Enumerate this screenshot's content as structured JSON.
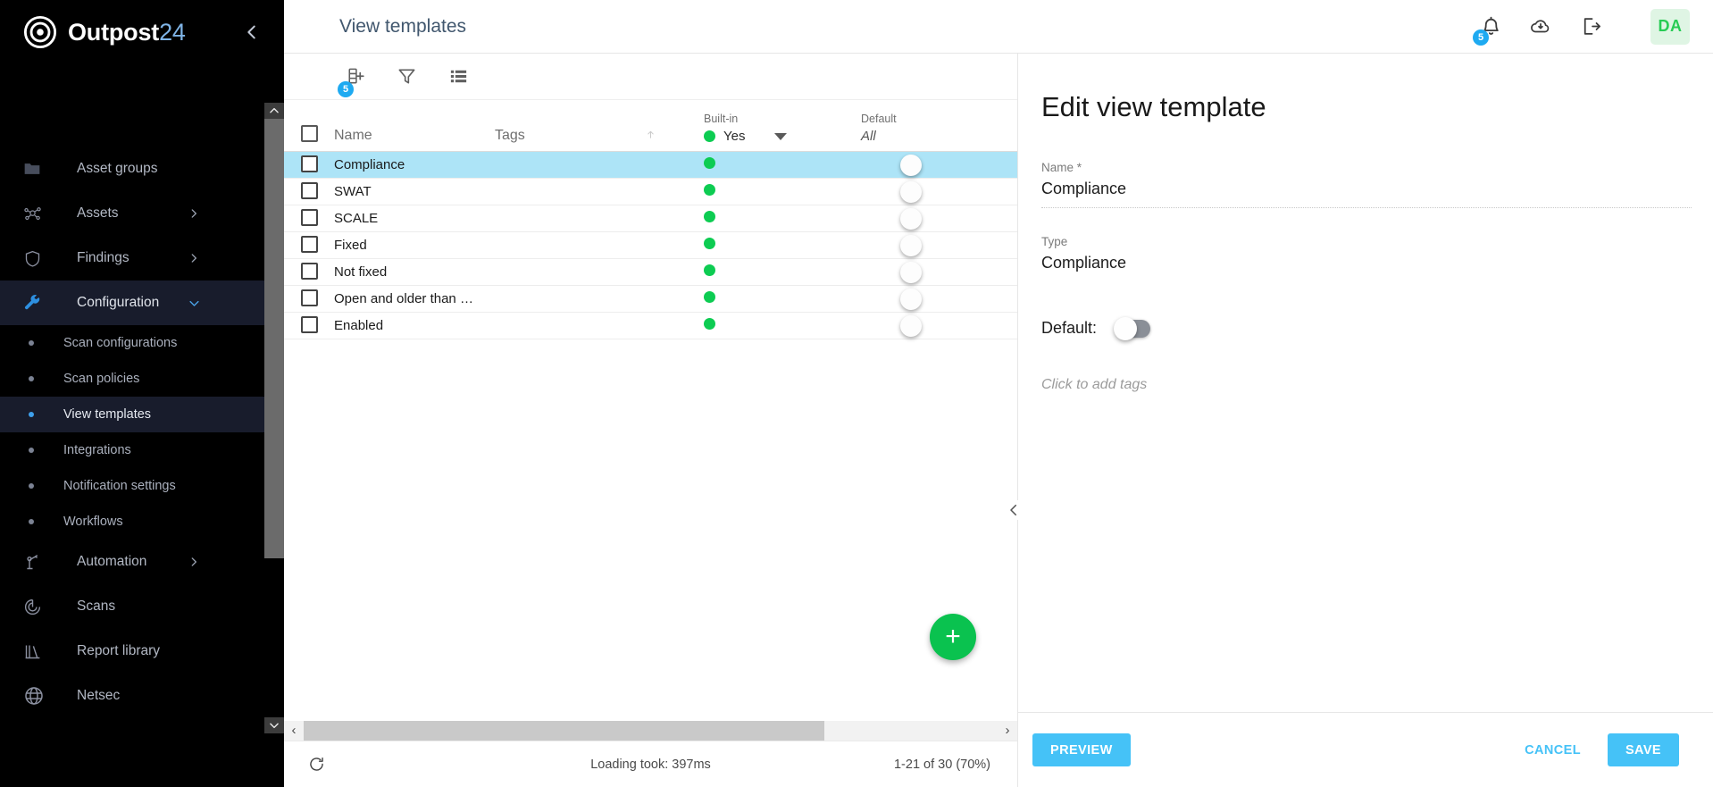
{
  "brand": {
    "name": "Outpost",
    "suffix": "24",
    "logo_icon": "target-logo-icon",
    "collapse_icon": "chevron-left-icon"
  },
  "sidebar": {
    "items": [
      {
        "label": "Asset groups",
        "icon": "folder-icon",
        "has_chevron": false,
        "type": "top",
        "active": false
      },
      {
        "label": "Assets",
        "icon": "assets-network-icon",
        "has_chevron": true,
        "type": "top",
        "active": false
      },
      {
        "label": "Findings",
        "icon": "shield-icon",
        "has_chevron": true,
        "type": "top",
        "active": false
      },
      {
        "label": "Configuration",
        "icon": "wrench-icon",
        "has_chevron": true,
        "type": "top",
        "active": true
      },
      {
        "label": "Scan configurations",
        "icon": "bullet-icon",
        "type": "sub",
        "active": false
      },
      {
        "label": "Scan policies",
        "icon": "bullet-icon",
        "type": "sub",
        "active": false
      },
      {
        "label": "View templates",
        "icon": "bullet-icon",
        "type": "sub",
        "active": true
      },
      {
        "label": "Integrations",
        "icon": "bullet-icon",
        "type": "sub",
        "active": false
      },
      {
        "label": "Notification settings",
        "icon": "bullet-icon",
        "type": "sub",
        "active": false
      },
      {
        "label": "Workflows",
        "icon": "bullet-icon",
        "type": "sub",
        "active": false
      },
      {
        "label": "Automation",
        "icon": "automation-icon",
        "has_chevron": true,
        "type": "top",
        "active": false
      },
      {
        "label": "Scans",
        "icon": "scan-target-icon",
        "has_chevron": false,
        "type": "top",
        "active": false
      },
      {
        "label": "Report library",
        "icon": "report-library-icon",
        "has_chevron": false,
        "type": "top",
        "active": false
      },
      {
        "label": "Netsec",
        "icon": "globe-icon",
        "has_chevron": false,
        "type": "top",
        "active": false
      }
    ],
    "scroll_up_icon": "chevron-up-icon",
    "scroll_down_icon": "chevron-down-icon"
  },
  "header": {
    "title": "View templates",
    "icons": [
      {
        "name": "notifications-bell-icon",
        "badge": "5"
      },
      {
        "name": "cloud-download-icon",
        "badge": ""
      },
      {
        "name": "logout-icon",
        "badge": ""
      }
    ],
    "avatar_initials": "DA"
  },
  "toolbar": {
    "icons": [
      {
        "name": "add-column-icon",
        "badge": "5"
      },
      {
        "name": "filter-funnel-icon",
        "badge": ""
      },
      {
        "name": "list-view-icon",
        "badge": ""
      }
    ]
  },
  "table": {
    "columns": {
      "name": "Name",
      "tags": "Tags",
      "builtin_label": "Built-in",
      "builtin_value": "Yes",
      "default_label": "Default",
      "default_value": "All"
    },
    "rows": [
      {
        "name": "Compliance",
        "tags": "",
        "builtin": true,
        "default_on": false,
        "selected": true
      },
      {
        "name": "SWAT",
        "tags": "",
        "builtin": true,
        "default_on": false,
        "selected": false
      },
      {
        "name": "SCALE",
        "tags": "",
        "builtin": true,
        "default_on": false,
        "selected": false
      },
      {
        "name": "Fixed",
        "tags": "",
        "builtin": true,
        "default_on": false,
        "selected": false
      },
      {
        "name": "Not fixed",
        "tags": "",
        "builtin": true,
        "default_on": false,
        "selected": false
      },
      {
        "name": "Open and older than …",
        "tags": "",
        "builtin": true,
        "default_on": false,
        "selected": false
      },
      {
        "name": "Enabled",
        "tags": "",
        "builtin": true,
        "default_on": false,
        "selected": false
      }
    ],
    "add_button_label": "+",
    "status": {
      "loading": "Loading took: 397ms",
      "pagination": "1-21 of 30 (70%)",
      "refresh_icon": "refresh-icon"
    }
  },
  "editor": {
    "title": "Edit view template",
    "name_label": "Name *",
    "name_value": "Compliance",
    "type_label": "Type",
    "type_value": "Compliance",
    "default_label": "Default:",
    "default_on": false,
    "tags_placeholder": "Click to add tags",
    "collapse_icon": "chevron-left-icon",
    "buttons": {
      "preview": "PREVIEW",
      "cancel": "CANCEL",
      "save": "SAVE"
    }
  },
  "colors": {
    "accent_blue": "#45c2f7",
    "green": "#0dcc52",
    "selected_row": "#ade4f7",
    "sidebar_bg": "#000000",
    "sidebar_active": "#181c2c",
    "badge_blue": "#1eaaf1"
  }
}
